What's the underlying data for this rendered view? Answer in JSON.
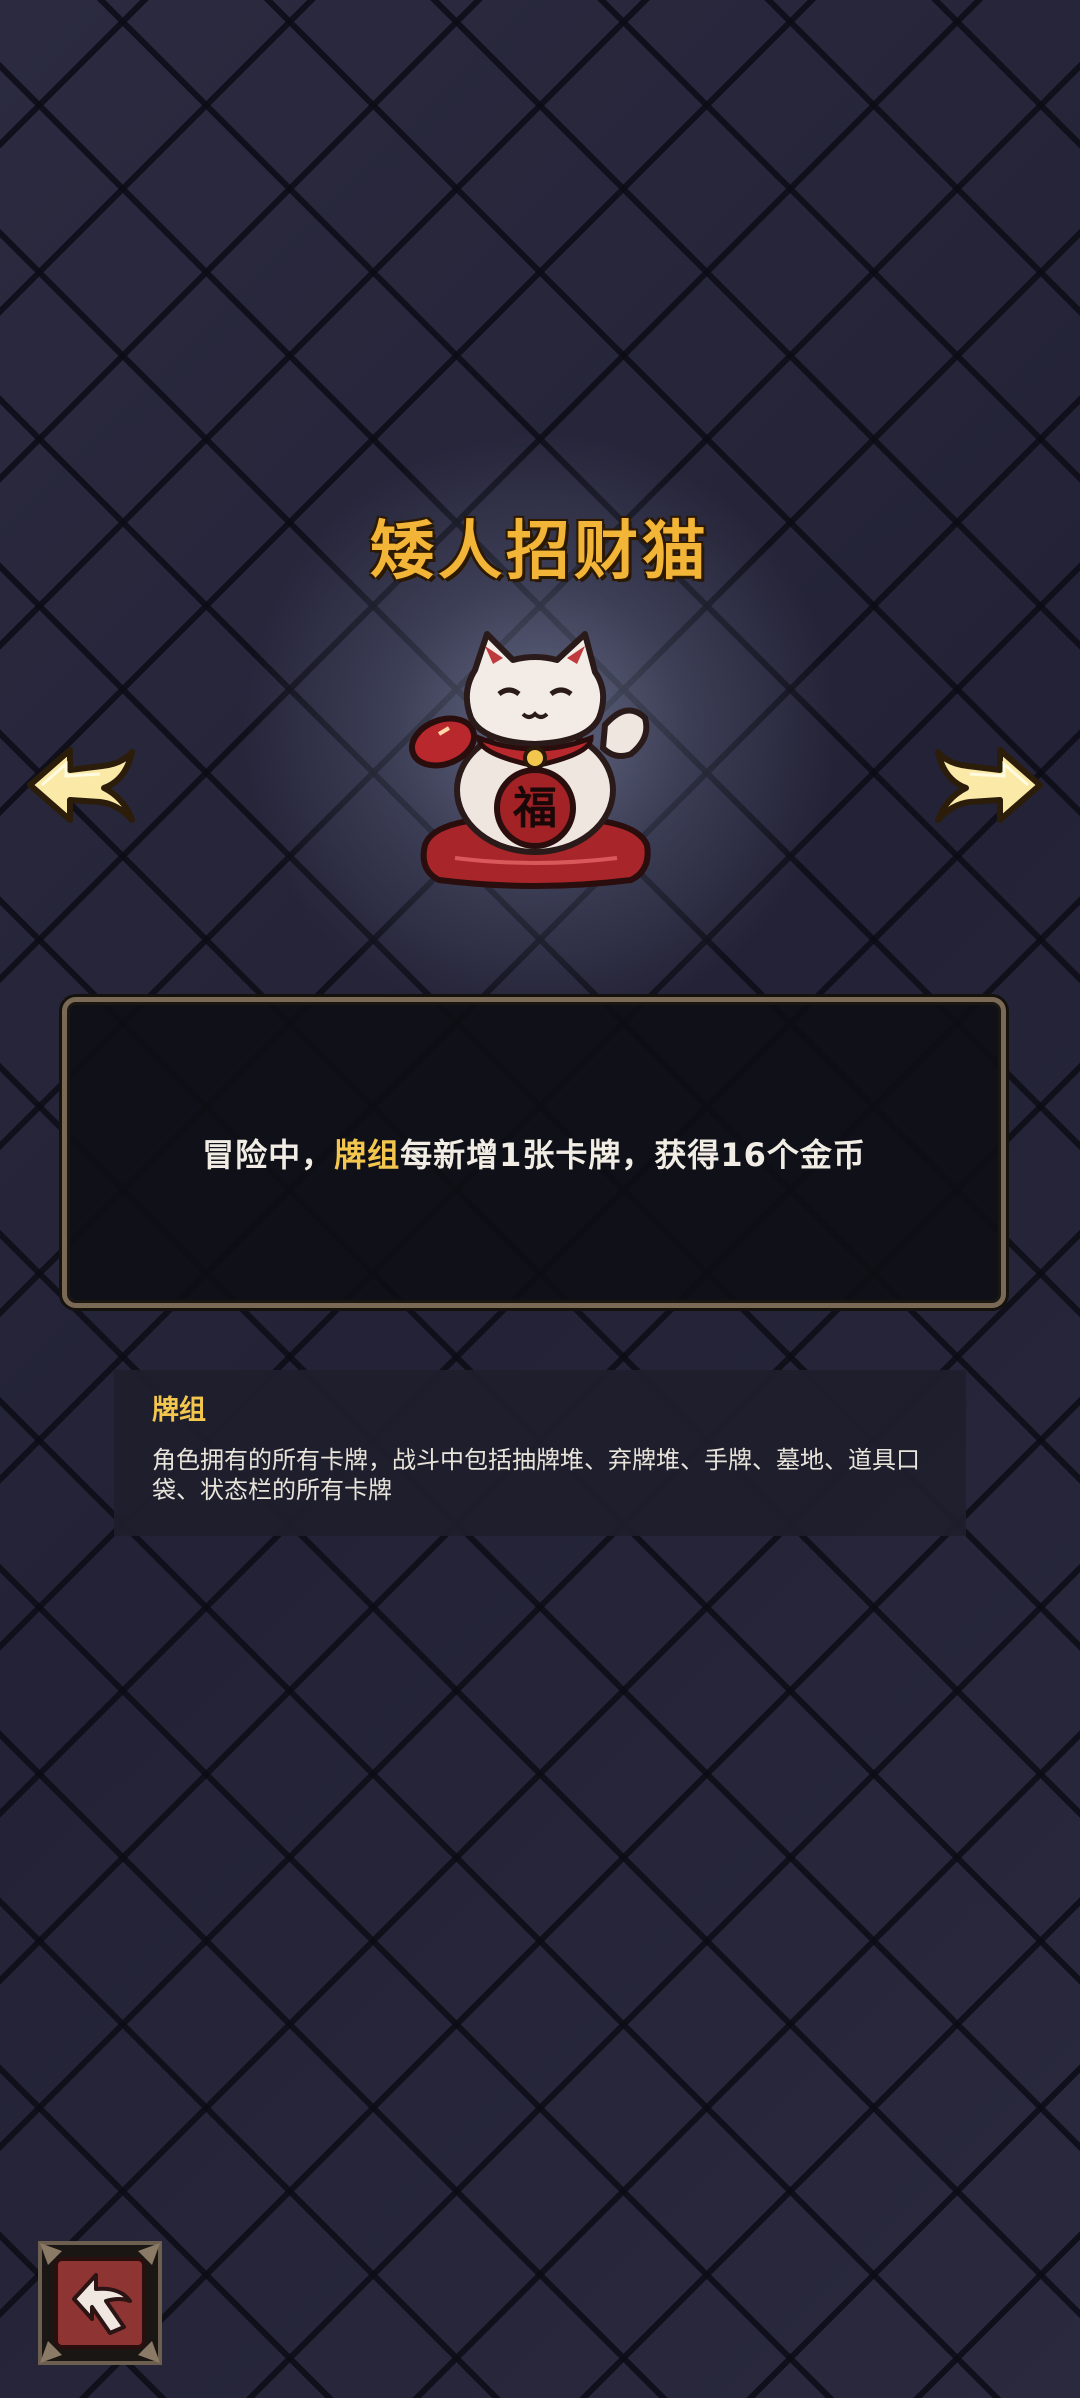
{
  "relic": {
    "name": "矮人招财猫",
    "icon": "lucky-cat-icon",
    "badge_char": "福"
  },
  "description": {
    "prefix": "冒险中，",
    "keyword": "牌组",
    "suffix": "每新增1张卡牌，获得16个金币"
  },
  "glossary": {
    "term": "牌组",
    "definition": "角色拥有的所有卡牌，战斗中包括抽牌堆、弃牌堆、手牌、墓地、道具口袋、状态栏的所有卡牌"
  },
  "navigation": {
    "prev_icon": "arrow-left-icon",
    "next_icon": "arrow-right-icon",
    "back_icon": "return-icon"
  },
  "colors": {
    "title": "#f3b537",
    "keyword": "#f3c64e",
    "background": "#25243a"
  }
}
